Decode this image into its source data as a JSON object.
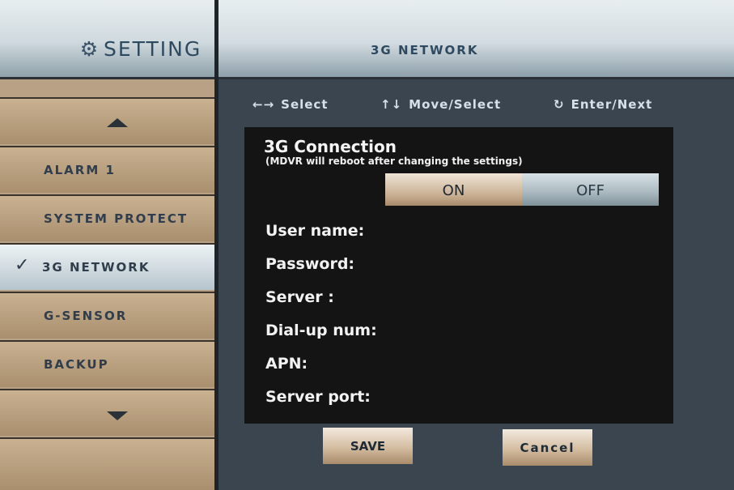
{
  "sidebar": {
    "title": "SETTING",
    "gear_icon": "⚙",
    "items": [
      {
        "label": "ALARM 1"
      },
      {
        "label": "SYSTEM PROTECT"
      },
      {
        "label": "3G NETWORK",
        "active": true,
        "check": "✓"
      },
      {
        "label": "G-SENSOR"
      },
      {
        "label": "BACKUP"
      }
    ]
  },
  "header": {
    "title": "3G NETWORK"
  },
  "hints": [
    {
      "icon": "←→",
      "label": "Select"
    },
    {
      "icon": "↑↓",
      "label": "Move/Select"
    },
    {
      "icon": "↻",
      "label": "Enter/Next"
    }
  ],
  "connection": {
    "title": "3G Connection",
    "note": "(MDVR will reboot after changing the settings)",
    "on_label": "ON",
    "off_label": "OFF",
    "selected": "ON"
  },
  "fields": [
    {
      "label": "User name:"
    },
    {
      "label": "Password:"
    },
    {
      "label": "Server :"
    },
    {
      "label": "Dial-up num:"
    },
    {
      "label": "APN:"
    },
    {
      "label": "Server port:"
    }
  ],
  "actions": {
    "save_label": "SAVE",
    "cancel_label": "Cancel"
  }
}
